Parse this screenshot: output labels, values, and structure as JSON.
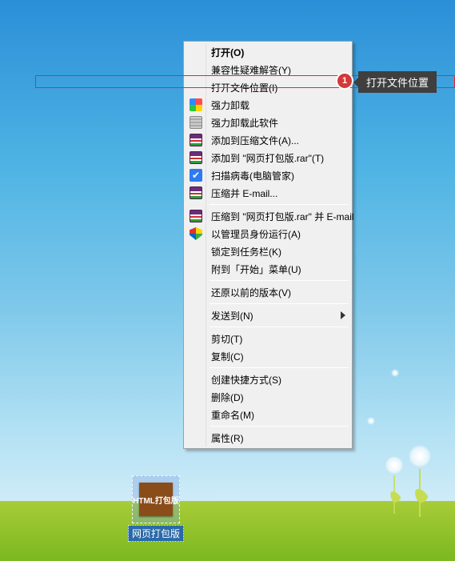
{
  "desktop": {
    "icon_label": "网页打包版",
    "icon_badge": "HTML打包版"
  },
  "menu": {
    "open": "打开(O)",
    "compat": "兼容性疑难解答(Y)",
    "open_location": "打开文件位置(I)",
    "force_uninstall": "强力卸载",
    "force_uninstall_this": "强力卸载此软件",
    "add_archive": "添加到压缩文件(A)...",
    "add_to_rar": "添加到 \"网页打包版.rar\"(T)",
    "scan_virus": "扫描病毒(电脑管家)",
    "compress_email": "压缩并 E-mail...",
    "compress_to_rar_email": "压缩到 \"网页打包版.rar\" 并 E-mail",
    "run_as_admin": "以管理员身份运行(A)",
    "pin_taskbar": "锁定到任务栏(K)",
    "pin_start": "附到「开始」菜单(U)",
    "restore_versions": "还原以前的版本(V)",
    "send_to": "发送到(N)",
    "cut": "剪切(T)",
    "copy": "复制(C)",
    "create_shortcut": "创建快捷方式(S)",
    "delete": "删除(D)",
    "rename": "重命名(M)",
    "properties": "属性(R)"
  },
  "callout": {
    "number": "1",
    "text": "打开文件位置"
  }
}
